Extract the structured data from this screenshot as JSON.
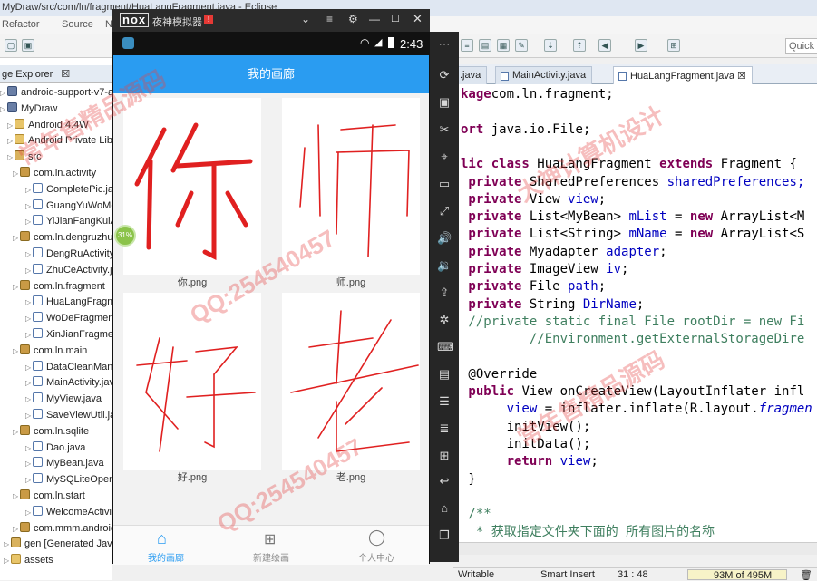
{
  "eclipse": {
    "title": "MyDraw/src/com/ln/fragment/HuaLangFragment.java - Eclipse",
    "menu": [
      "Refactor",
      "Source",
      "N"
    ],
    "quick_access": "Quick"
  },
  "package_explorer": {
    "tab_label": "ge Explorer",
    "tab_close": "☒",
    "tree": [
      "android-support-v7-appc",
      "MyDraw",
      "Android 4.4W",
      "Android Private Librar",
      "src",
      "com.ln.activity",
      "CompletePic.java",
      "GuangYuWoMe",
      "YiJianFangKuiAc",
      "com.ln.dengruzhuc",
      "DengRuActivity.j",
      "ZhuCeActivity.jav",
      "com.ln.fragment",
      "HuaLangFragm",
      "WoDeFragment",
      "XinJianFragmen",
      "com.ln.main",
      "DataCleanMana",
      "MainActivity.java",
      "MyView.java",
      "SaveViewUtil.jav",
      "com.ln.sqlite",
      "Dao.java",
      "MyBean.java",
      "MySQLiteOpenH",
      "com.ln.start",
      "WelcomeActivit",
      "com.mmm.android",
      "gen [Generated Java F",
      "assets"
    ]
  },
  "editor": {
    "tabs": [
      ".java",
      "MainActivity.java",
      "HuaLangFragment.java"
    ],
    "tab_close": "☒",
    "lines": [
      {
        "k": "",
        "t": "kage com.ln.fragment;",
        "seg": [
          [
            "kw",
            "kage"
          ],
          [
            "",
            "com.ln.fragment;"
          ]
        ]
      },
      {
        "seg": []
      },
      {
        "seg": [
          [
            "kw",
            "ort"
          ],
          [
            "",
            " java.io.File;"
          ]
        ]
      },
      {
        "seg": []
      },
      {
        "seg": [
          [
            "kw",
            "lic class"
          ],
          [
            "",
            " HuaLangFragment "
          ],
          [
            "kw",
            "extends"
          ],
          [
            "",
            " Fragment {"
          ]
        ]
      },
      {
        "seg": [
          [
            "kw",
            " private"
          ],
          [
            "",
            " SharedPreferences "
          ],
          [
            "fld",
            "sharedPreferences;"
          ]
        ]
      },
      {
        "seg": [
          [
            "kw",
            " private"
          ],
          [
            "",
            " View "
          ],
          [
            "fld",
            "view"
          ],
          [
            "",
            ";"
          ]
        ]
      },
      {
        "seg": [
          [
            "kw",
            " private"
          ],
          [
            "",
            " List<MyBean> "
          ],
          [
            "fld",
            "mList"
          ],
          [
            "",
            " = "
          ],
          [
            "kw",
            "new"
          ],
          [
            "",
            " ArrayList<M"
          ]
        ]
      },
      {
        "seg": [
          [
            "kw",
            " private"
          ],
          [
            "",
            " List<String> "
          ],
          [
            "fld",
            "mName"
          ],
          [
            "",
            " = "
          ],
          [
            "kw",
            "new"
          ],
          [
            "",
            " ArrayList<S"
          ]
        ]
      },
      {
        "seg": [
          [
            "kw",
            " private"
          ],
          [
            "",
            " Myadapter "
          ],
          [
            "fld",
            "adapter"
          ],
          [
            "",
            ";"
          ]
        ]
      },
      {
        "seg": [
          [
            "kw",
            " private"
          ],
          [
            "",
            " ImageView "
          ],
          [
            "fld",
            "iv"
          ],
          [
            "",
            ";"
          ]
        ]
      },
      {
        "seg": [
          [
            "kw",
            " private"
          ],
          [
            "",
            " File "
          ],
          [
            "fld",
            "path"
          ],
          [
            "",
            ";"
          ]
        ]
      },
      {
        "seg": [
          [
            "kw",
            " private"
          ],
          [
            "",
            " String "
          ],
          [
            "fld",
            "DirName"
          ],
          [
            "",
            ";"
          ]
        ]
      },
      {
        "seg": [
          [
            "cm",
            " //private static final File rootDir = new Fi"
          ]
        ]
      },
      {
        "seg": [
          [
            "cm",
            "         //Environment.getExternalStorageDire"
          ]
        ]
      },
      {
        "seg": []
      },
      {
        "seg": [
          [
            "",
            " @Override"
          ]
        ]
      },
      {
        "seg": [
          [
            "kw",
            " public"
          ],
          [
            "",
            " View onCreateView(LayoutInflater infl"
          ]
        ]
      },
      {
        "seg": [
          [
            "",
            "      "
          ],
          [
            "fld",
            "view"
          ],
          [
            "",
            " = inflater.inflate(R.layout."
          ],
          [
            "fldit",
            "fragmen"
          ]
        ]
      },
      {
        "seg": [
          [
            "",
            "      initView();"
          ]
        ]
      },
      {
        "seg": [
          [
            "",
            "      initData();"
          ]
        ]
      },
      {
        "seg": [
          [
            "kw",
            "      return"
          ],
          [
            "",
            " "
          ],
          [
            "fld",
            "view"
          ],
          [
            "",
            ";"
          ]
        ]
      },
      {
        "seg": [
          [
            "",
            " }"
          ]
        ]
      },
      {
        "seg": []
      },
      {
        "seg": [
          [
            "cm",
            " /**"
          ]
        ]
      },
      {
        "seg": [
          [
            "cm",
            "  * 获取指定文件夹下面的 所有图片的名称"
          ]
        ]
      }
    ]
  },
  "status_bar": {
    "writable": "Writable",
    "insert_mode": "Smart Insert",
    "position": "31 : 48",
    "heap": "93M of 495M"
  },
  "emulator": {
    "logo": "nox",
    "title": "夜神模拟器",
    "clock": "2:43",
    "app_title": "我的画廊",
    "progress": "31%",
    "images": [
      {
        "caption": "你.png",
        "glyph": "你"
      },
      {
        "caption": "师.png",
        "glyph": "师"
      },
      {
        "caption": "好.png",
        "glyph": "好"
      },
      {
        "caption": "老.png",
        "glyph": "老"
      }
    ],
    "nav": [
      "我的画廊",
      "新建绘画",
      "个人中心"
    ],
    "colors": {
      "accent": "#2a9cf1",
      "ink": "#e02020"
    }
  },
  "watermarks": [
    "QQ:254540457",
    "常年售精品源码",
    "大神计算机设计"
  ]
}
